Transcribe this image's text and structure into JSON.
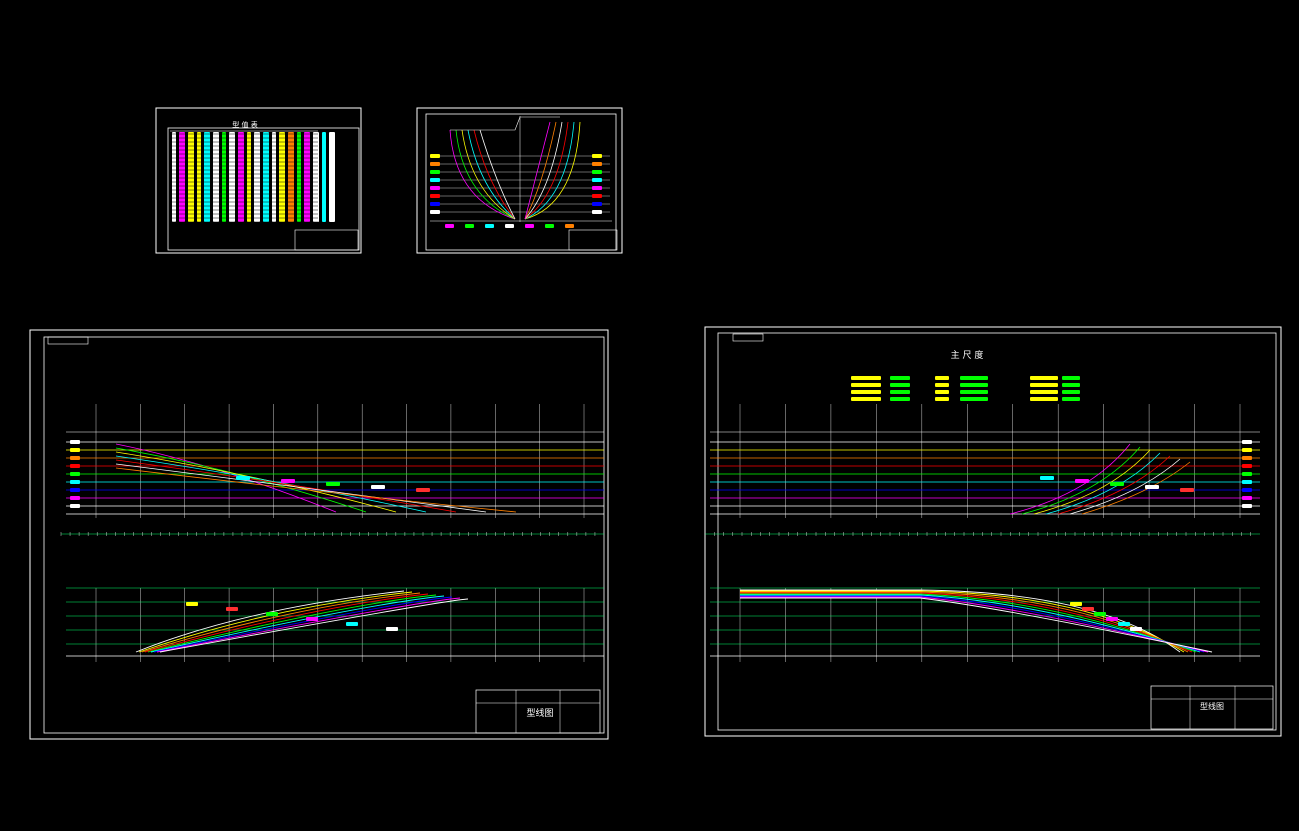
{
  "sheets": {
    "offset_table": {
      "title": "型 值 表"
    },
    "body_plan": {
      "labels": []
    },
    "lines_plan_aft": {
      "title_block": {
        "drawing_name": "型线图"
      }
    },
    "lines_plan_fore": {
      "main_dimensions": {
        "heading": "主 尺 度"
      },
      "title_block": {
        "drawing_name": "型线图"
      }
    }
  },
  "colors": {
    "frame": "#ffffff",
    "grid": "#ffffff",
    "waterlines": [
      "#ffffff",
      "#ffff00",
      "#ff8000",
      "#ff0000",
      "#00ff00",
      "#00ffff",
      "#0000ff",
      "#ff00ff",
      "#ffffff"
    ],
    "stations": [
      "#ff00ff",
      "#00ff00",
      "#ffff00",
      "#00ffff",
      "#ff0000",
      "#ffffff",
      "#ff8000"
    ],
    "accent_green": "#00ff66",
    "accent_red": "#ff3030"
  }
}
